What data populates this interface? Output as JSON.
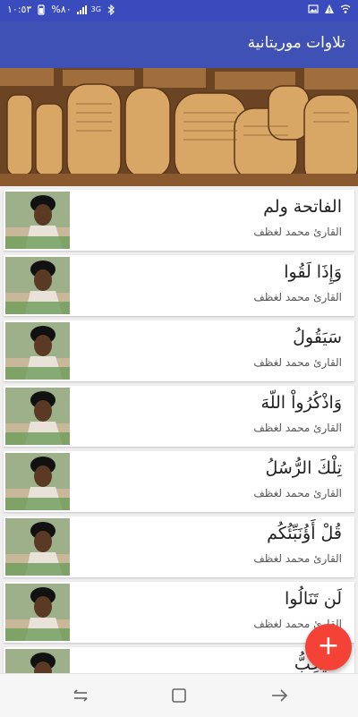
{
  "status_bar": {
    "time": "١٠:٥٣",
    "battery": "%٨٠",
    "network": "3G"
  },
  "app_bar": {
    "title": "تلاوات موريتانية"
  },
  "header_image": {
    "subject": "ancient manuscript tablets"
  },
  "recitations": [
    {
      "title": "الفاتحة ولم",
      "reciter": "القارئ محمد لغظف"
    },
    {
      "title": "وَإِذَا لَقُوا",
      "reciter": "القارئ محمد لغظف"
    },
    {
      "title": "سَيَقُولُ",
      "reciter": "القارئ محمد لغظف"
    },
    {
      "title": "وَاذْكُرُواْ اللّهَ",
      "reciter": "القارئ محمد لغظف"
    },
    {
      "title": "تِلْكَ الرُّسُلُ",
      "reciter": "القارئ محمد لغظف"
    },
    {
      "title": "قُلْ أَؤُنَبِّئُكُم",
      "reciter": "القارئ محمد لغظف"
    },
    {
      "title": "لَن تَنَالُوا",
      "reciter": "القارئ محمد لغظف"
    },
    {
      "title": "لَا يُحِبُّ",
      "reciter": ""
    }
  ],
  "fab": {
    "label": "+"
  },
  "nav": {
    "back": "back-icon",
    "home": "home-icon",
    "recents": "recents-icon"
  },
  "colors": {
    "app_bar": "#3f51b5",
    "status_bar": "#3a4bbd",
    "fab": "#f44336"
  }
}
